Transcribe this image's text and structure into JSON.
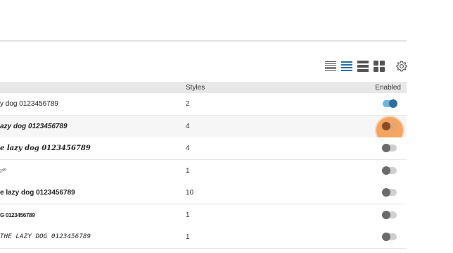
{
  "toolbar": {
    "views": [
      {
        "name": "compact-list-view-icon"
      },
      {
        "name": "list-view-icon",
        "active": true
      },
      {
        "name": "large-list-view-icon"
      },
      {
        "name": "grid-view-icon"
      }
    ],
    "settings_icon": "gear-icon",
    "active_color": "#2d6f9c"
  },
  "table": {
    "headers": {
      "styles": "Styles",
      "enabled": "Enabled"
    },
    "rows": [
      {
        "sample": "y dog 0123456789",
        "styles": "2",
        "enabled": true,
        "style": "regular"
      },
      {
        "sample": "azy dog 0123456789",
        "styles": "4",
        "enabled": false,
        "focused": true,
        "style": "bold-italic"
      },
      {
        "sample": "e lazy dog 0123456789",
        "styles": "4",
        "enabled": false,
        "style": "serif-bold-italic"
      },
      {
        "sample": "ı⁴⁹",
        "styles": "1",
        "enabled": false,
        "style": "script"
      },
      {
        "sample": "e lazy dog 0123456789",
        "styles": "10",
        "enabled": false,
        "style": "bold"
      },
      {
        "sample": "G 0123456789",
        "styles": "1",
        "enabled": false,
        "style": "condensed"
      },
      {
        "sample": "THE LAZY DOG 0123456789",
        "styles": "1",
        "enabled": false,
        "style": "hand"
      }
    ]
  },
  "colors": {
    "toggle_on_track": "#6fb3db",
    "toggle_on_knob": "#2d6f9c",
    "toggle_off_track": "#cfcfcf",
    "toggle_off_knob": "#6b6b6b",
    "focus_highlight": "#f29646"
  }
}
